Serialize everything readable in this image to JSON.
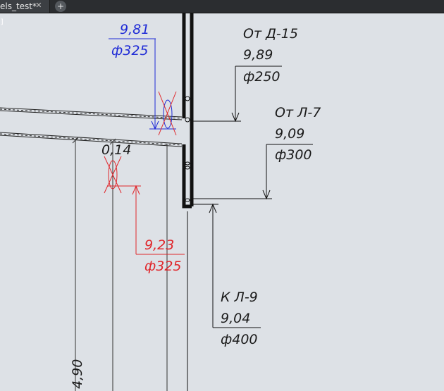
{
  "tabs": [
    {
      "label": "els_test*",
      "close_icon": "close-icon"
    }
  ],
  "add_tab_icon": "plus-icon",
  "viewport_marker": "]",
  "colors": {
    "background": "#dde1e6",
    "blue": "#1f2bd6",
    "red": "#e0262b",
    "black": "#1a1a1a"
  },
  "annotations": {
    "blue_pipe": {
      "level": "9,81",
      "diameter": "ф325"
    },
    "from_d15": {
      "title": "От Д-15",
      "level": "9,89",
      "diameter": "ф250"
    },
    "from_l7": {
      "title": "От Л-7",
      "level": "9,09",
      "diameter": "ф300"
    },
    "red_pipe": {
      "level": "9,23",
      "diameter": "ф325"
    },
    "to_l9": {
      "title": "К Л-9",
      "level": "9,04",
      "diameter": "ф400"
    },
    "slope_value": "0,14",
    "vertical_dim": "4,90"
  }
}
